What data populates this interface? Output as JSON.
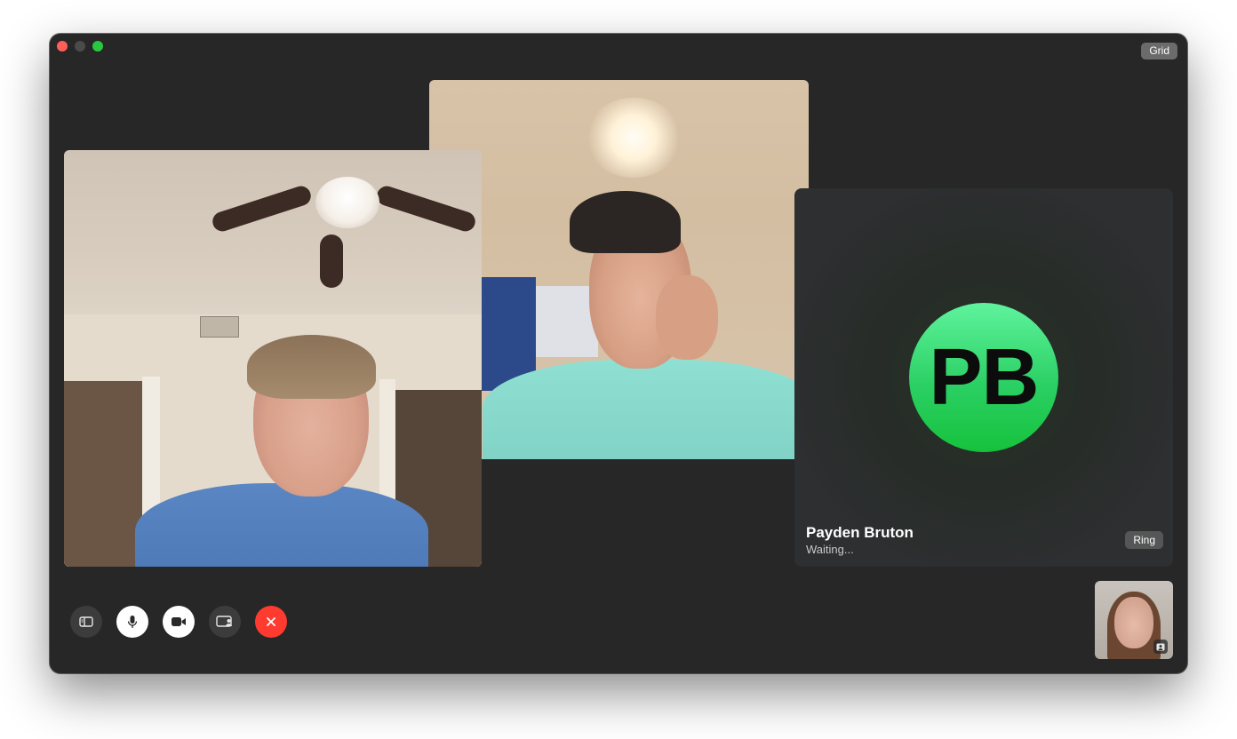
{
  "toolbar": {
    "grid_label": "Grid"
  },
  "participants": {
    "left": {
      "kind": "video"
    },
    "center": {
      "kind": "video"
    },
    "payden": {
      "initials": "PB",
      "name": "Payden Bruton",
      "status": "Waiting...",
      "ring_label": "Ring",
      "avatar_color": "#2bd064"
    }
  },
  "controls": [
    {
      "name": "sidebar-toggle",
      "icon": "sidebar-icon"
    },
    {
      "name": "mute",
      "icon": "microphone-icon"
    },
    {
      "name": "camera",
      "icon": "video-camera-icon"
    },
    {
      "name": "share-screen",
      "icon": "screen-share-icon"
    },
    {
      "name": "leave",
      "icon": "close-icon",
      "color": "#ff3b30"
    }
  ],
  "self_view": {
    "icon": "person-frame-icon"
  }
}
